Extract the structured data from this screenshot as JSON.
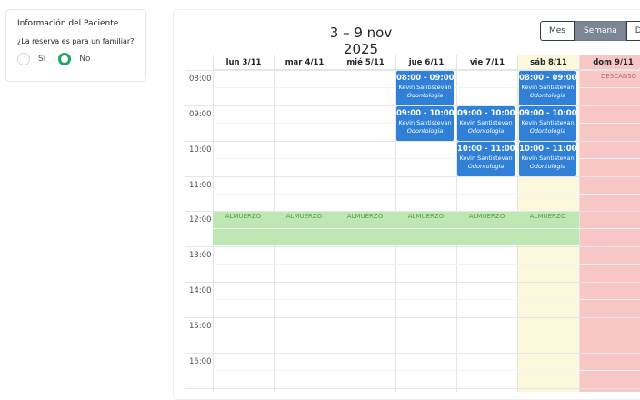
{
  "patient": {
    "title": "Información del Paciente",
    "question": "¿La reserva es para un familiar?",
    "options": [
      {
        "label": "Sí",
        "selected": false
      },
      {
        "label": "No",
        "selected": true
      }
    ]
  },
  "calendar": {
    "title": "3 – 9 nov 2025",
    "views": [
      {
        "label": "Mes",
        "active": false
      },
      {
        "label": "Semana",
        "active": true
      },
      {
        "label": "Día",
        "active": false
      }
    ],
    "days": [
      {
        "label": "lun 3/11"
      },
      {
        "label": "mar 4/11"
      },
      {
        "label": "mié 5/11"
      },
      {
        "label": "jue 6/11"
      },
      {
        "label": "vie 7/11"
      },
      {
        "label": "sáb 8/11"
      },
      {
        "label": "dom 9/11"
      }
    ],
    "hours": [
      "08:00",
      "09:00",
      "10:00",
      "11:00",
      "12:00",
      "13:00",
      "14:00",
      "15:00",
      "16:00"
    ],
    "lunch_label": "ALMUERZO",
    "sunday_label": "DESCANSO",
    "events": [
      {
        "time": "08:00 - 09:00",
        "name": "Kevin Santistevan",
        "specialty": "Odontologia"
      },
      {
        "time": "09:00 - 10:00",
        "name": "Kevin Santistevan",
        "specialty": "Odontologia"
      },
      {
        "time": "09:00 - 10:00",
        "name": "Kevin Santistevan",
        "specialty": "Odontologia"
      },
      {
        "time": "10:00 - 11:00",
        "name": "Kevin Santistevan",
        "specialty": "Odontologia"
      },
      {
        "time": "08:00 - 09:00",
        "name": "Kevin Santistevan",
        "specialty": "Odontologia"
      },
      {
        "time": "09:00 - 10:00",
        "name": "Kevin Santistevan",
        "specialty": "Odontologia"
      },
      {
        "time": "10:00 - 11:00",
        "name": "Kevin Santistevan",
        "specialty": "Odontologia"
      }
    ]
  }
}
